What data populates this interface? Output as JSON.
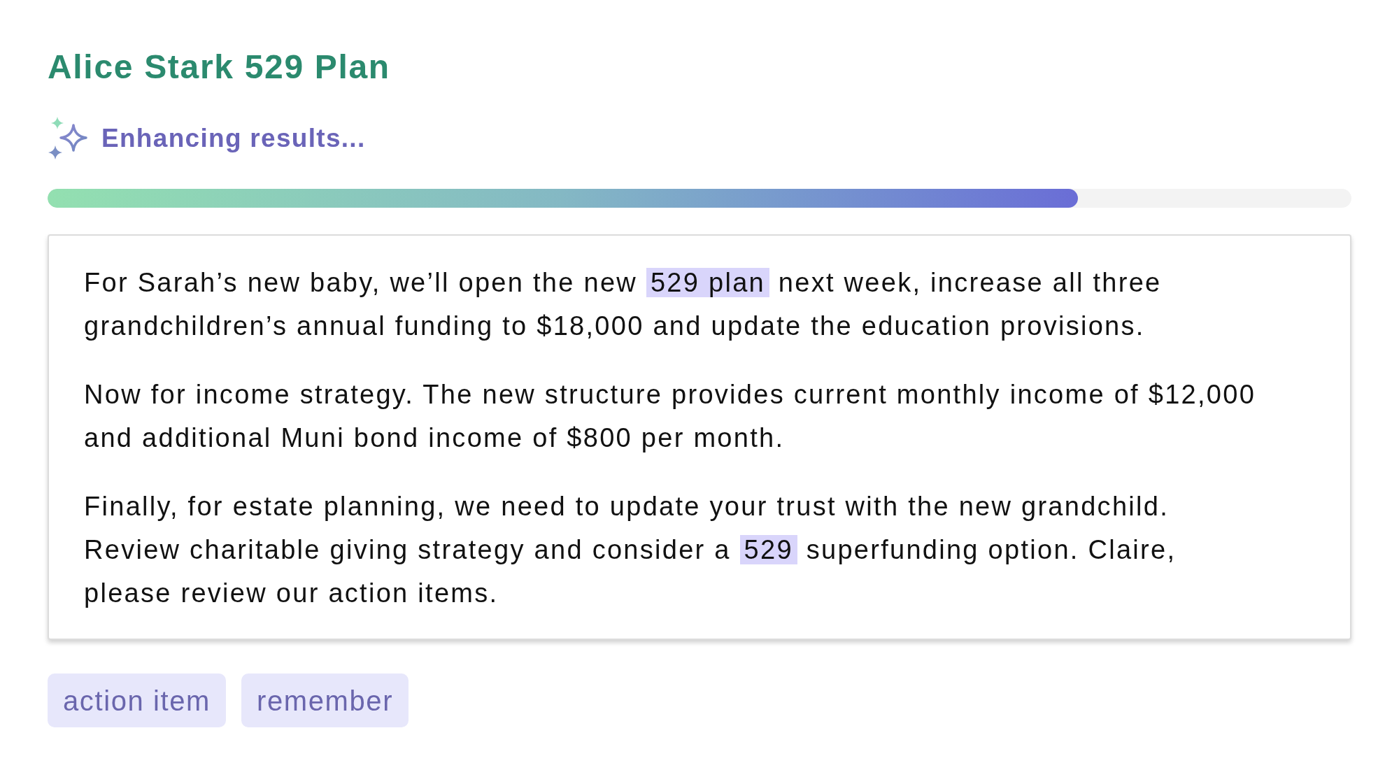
{
  "title": "Alice Stark 529 Plan",
  "status": {
    "label": "Enhancing results..."
  },
  "progress": {
    "level": 0.79
  },
  "note": {
    "paragraphs": [
      {
        "segments": [
          {
            "text": "For Sarah’s new baby, we’ll open the new ",
            "highlighted": false
          },
          {
            "text": "529 plan",
            "highlighted": true
          },
          {
            "text": " next week, increase all three grandchildren’s annual funding to $18,000 and update the education provisions.",
            "highlighted": false
          }
        ]
      },
      {
        "segments": [
          {
            "text": "Now for income strategy. The new structure provides current monthly income of $12,000 and additional Muni bond income of $800 per month.",
            "highlighted": false
          }
        ]
      },
      {
        "segments": [
          {
            "text": "Finally, for estate planning, we need to update your trust with the new grandchild. Review charitable giving strategy and consider a ",
            "highlighted": false
          },
          {
            "text": "529",
            "highlighted": true
          },
          {
            "text": " superfunding option. Claire, please review our action items.",
            "highlighted": false
          }
        ]
      }
    ]
  },
  "tags": [
    "action item",
    "remember"
  ]
}
